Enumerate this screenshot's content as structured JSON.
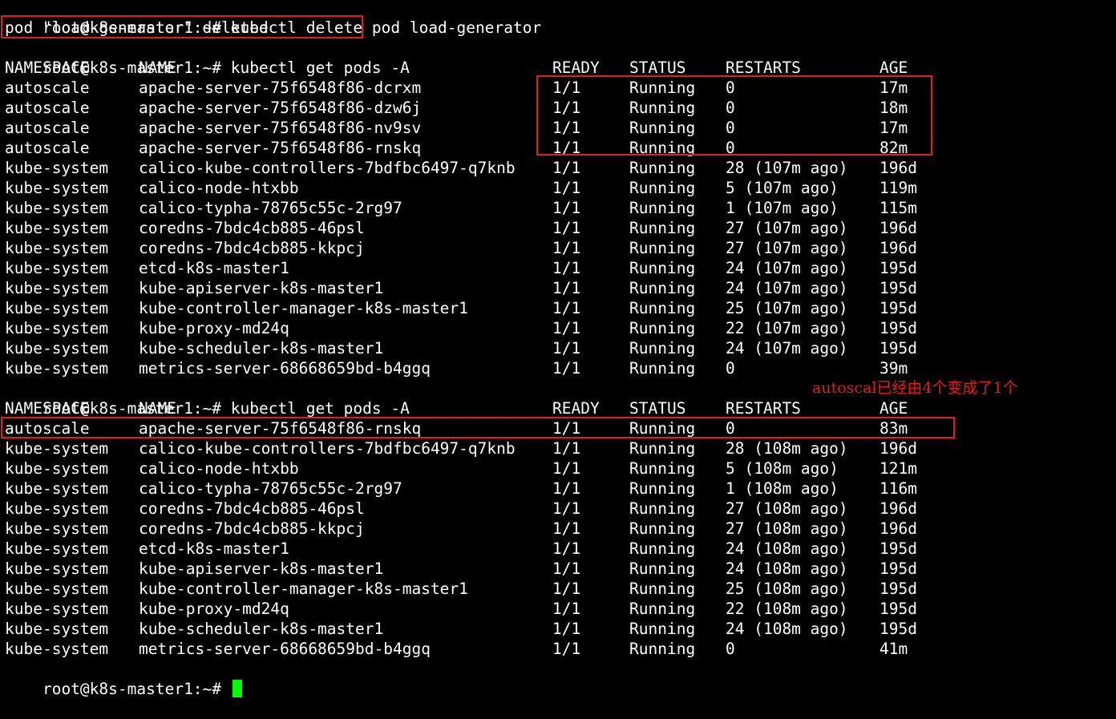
{
  "colors": {
    "background": "#000000",
    "text": "#ffffff",
    "highlight": "#e0201a",
    "cursor": "#00ff00"
  },
  "prompt": "root@k8s-master1:~#",
  "commands": {
    "delete": "kubectl delete pod load-generator",
    "get_first": "kubectl get pods -A",
    "get_second": "kubectl get pods -A"
  },
  "delete_output": "pod \"load-generator\" deleted",
  "headers": {
    "namespace": "NAMESPACE",
    "name": "NAME",
    "ready": "READY",
    "status": "STATUS",
    "restarts": "RESTARTS",
    "age": "AGE"
  },
  "listing_1": [
    [
      "autoscale",
      "apache-server-75f6548f86-dcrxm",
      "1/1",
      "Running",
      "0",
      "17m"
    ],
    [
      "autoscale",
      "apache-server-75f6548f86-dzw6j",
      "1/1",
      "Running",
      "0",
      "18m"
    ],
    [
      "autoscale",
      "apache-server-75f6548f86-nv9sv",
      "1/1",
      "Running",
      "0",
      "17m"
    ],
    [
      "autoscale",
      "apache-server-75f6548f86-rnskq",
      "1/1",
      "Running",
      "0",
      "82m"
    ],
    [
      "kube-system",
      "calico-kube-controllers-7bdfbc6497-q7knb",
      "1/1",
      "Running",
      "28 (107m ago)",
      "196d"
    ],
    [
      "kube-system",
      "calico-node-htxbb",
      "1/1",
      "Running",
      "5 (107m ago)",
      "119m"
    ],
    [
      "kube-system",
      "calico-typha-78765c55c-2rg97",
      "1/1",
      "Running",
      "1 (107m ago)",
      "115m"
    ],
    [
      "kube-system",
      "coredns-7bdc4cb885-46psl",
      "1/1",
      "Running",
      "27 (107m ago)",
      "196d"
    ],
    [
      "kube-system",
      "coredns-7bdc4cb885-kkpcj",
      "1/1",
      "Running",
      "27 (107m ago)",
      "196d"
    ],
    [
      "kube-system",
      "etcd-k8s-master1",
      "1/1",
      "Running",
      "24 (107m ago)",
      "195d"
    ],
    [
      "kube-system",
      "kube-apiserver-k8s-master1",
      "1/1",
      "Running",
      "24 (107m ago)",
      "195d"
    ],
    [
      "kube-system",
      "kube-controller-manager-k8s-master1",
      "1/1",
      "Running",
      "25 (107m ago)",
      "195d"
    ],
    [
      "kube-system",
      "kube-proxy-md24q",
      "1/1",
      "Running",
      "22 (107m ago)",
      "195d"
    ],
    [
      "kube-system",
      "kube-scheduler-k8s-master1",
      "1/1",
      "Running",
      "24 (107m ago)",
      "195d"
    ],
    [
      "kube-system",
      "metrics-server-68668659bd-b4ggq",
      "1/1",
      "Running",
      "0",
      "39m"
    ]
  ],
  "listing_2": [
    [
      "autoscale",
      "apache-server-75f6548f86-rnskq",
      "1/1",
      "Running",
      "0",
      "83m"
    ],
    [
      "kube-system",
      "calico-kube-controllers-7bdfbc6497-q7knb",
      "1/1",
      "Running",
      "28 (108m ago)",
      "196d"
    ],
    [
      "kube-system",
      "calico-node-htxbb",
      "1/1",
      "Running",
      "5 (108m ago)",
      "121m"
    ],
    [
      "kube-system",
      "calico-typha-78765c55c-2rg97",
      "1/1",
      "Running",
      "1 (108m ago)",
      "116m"
    ],
    [
      "kube-system",
      "coredns-7bdc4cb885-46psl",
      "1/1",
      "Running",
      "27 (108m ago)",
      "196d"
    ],
    [
      "kube-system",
      "coredns-7bdc4cb885-kkpcj",
      "1/1",
      "Running",
      "27 (108m ago)",
      "196d"
    ],
    [
      "kube-system",
      "etcd-k8s-master1",
      "1/1",
      "Running",
      "24 (108m ago)",
      "195d"
    ],
    [
      "kube-system",
      "kube-apiserver-k8s-master1",
      "1/1",
      "Running",
      "24 (108m ago)",
      "195d"
    ],
    [
      "kube-system",
      "kube-controller-manager-k8s-master1",
      "1/1",
      "Running",
      "25 (108m ago)",
      "195d"
    ],
    [
      "kube-system",
      "kube-proxy-md24q",
      "1/1",
      "Running",
      "22 (108m ago)",
      "195d"
    ],
    [
      "kube-system",
      "kube-scheduler-k8s-master1",
      "1/1",
      "Running",
      "24 (108m ago)",
      "195d"
    ],
    [
      "kube-system",
      "metrics-server-68668659bd-b4ggq",
      "1/1",
      "Running",
      "0",
      "41m"
    ]
  ],
  "annotation": "autoscal已经由4个变成了1个"
}
